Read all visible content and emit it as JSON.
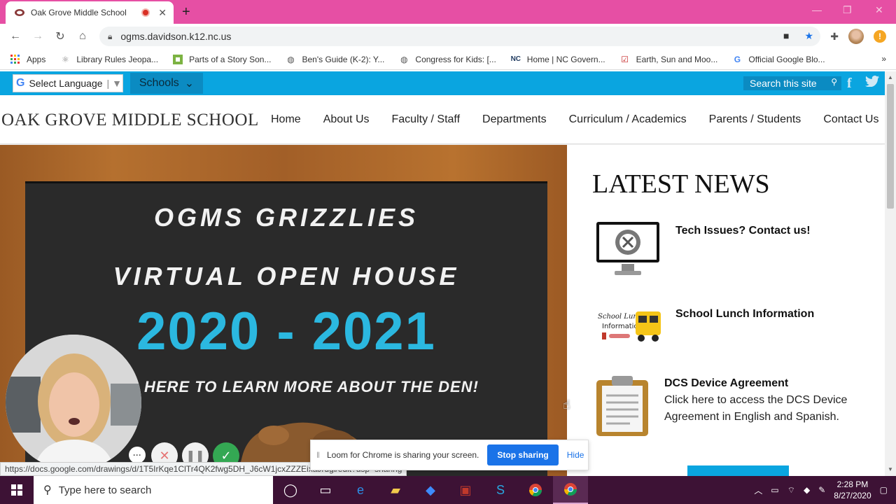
{
  "browser": {
    "tab_title": "Oak Grove Middle School",
    "url": "ogms.davidson.k12.nc.us",
    "bookmarks": [
      {
        "label": "Apps",
        "icon": "apps-grid-icon"
      },
      {
        "label": "Library Rules Jeopa...",
        "icon": "atom-icon"
      },
      {
        "label": "Parts of a Story Son...",
        "icon": "green-square-icon"
      },
      {
        "label": "Ben's Guide (K-2): Y...",
        "icon": "globe-icon"
      },
      {
        "label": "Congress for Kids: [...",
        "icon": "globe-icon"
      },
      {
        "label": "Home | NC Govern...",
        "icon": "nc-logo-icon"
      },
      {
        "label": "Earth, Sun and Moo...",
        "icon": "checkbox-icon"
      },
      {
        "label": "Official Google Blo...",
        "icon": "google-g-icon"
      }
    ],
    "bookmarks_more": "»"
  },
  "site": {
    "select_language": "Select Language",
    "schools_label": "Schools",
    "search_placeholder": "Search this site",
    "logo": "OAK GROVE MIDDLE SCHOOL",
    "nav": [
      "Home",
      "About Us",
      "Faculty / Staff",
      "Departments",
      "Curriculum / Academics",
      "Parents / Students",
      "Contact Us"
    ]
  },
  "hero": {
    "line1": "OGMS GRIZZLIES",
    "line2": "VIRTUAL OPEN HOUSE",
    "year": "2020 - 2021",
    "line3": "HERE TO LEARN MORE ABOUT THE DEN!"
  },
  "news": {
    "heading": "LATEST NEWS",
    "items": [
      {
        "title": "Tech Issues? Contact us!",
        "desc": ""
      },
      {
        "title": "School Lunch Information",
        "desc": "",
        "icon_text_1": "School Lunch",
        "icon_text_2": "Information"
      },
      {
        "title": "DCS Device Agreement",
        "desc": "Click here to access the DCS Device Agreement in English and Spanish."
      }
    ]
  },
  "overlay": {
    "status_url": "https://docs.google.com/drawings/d/1T5IrKqe1ClTr4QK2fwg5DH_J6cW1jcxZZZEixaJrdgi/edit?usp=sharing",
    "loom_message": "Loom for Chrome is sharing your screen.",
    "loom_stop": "Stop sharing",
    "loom_hide": "Hide"
  },
  "taskbar": {
    "search_placeholder": "Type here to search",
    "time": "2:28 PM",
    "date": "8/27/2020"
  },
  "colors": {
    "titlebar": "#e64fa4",
    "site_accent": "#0aa5e0",
    "year_text": "#2bb8e0",
    "taskbar": "#3d1235"
  }
}
